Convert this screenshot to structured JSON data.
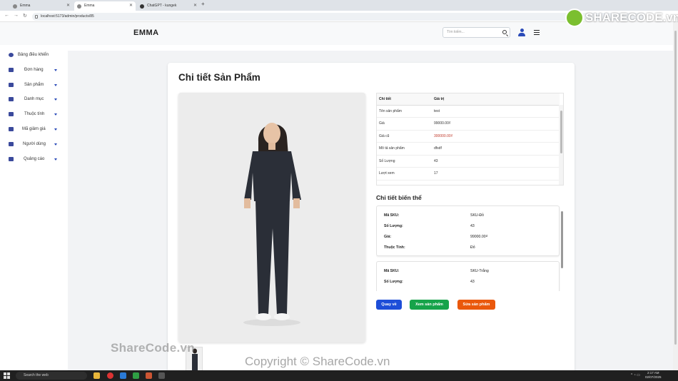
{
  "browser": {
    "tabs": [
      {
        "title": "Emma",
        "active": false
      },
      {
        "title": "Emma",
        "active": true
      },
      {
        "title": "ChatGPT - kungek",
        "active": false
      }
    ],
    "url": "localhost:5173/admin/products/85"
  },
  "header": {
    "brand": "EMMA",
    "search_placeholder": "Tìm kiếm..."
  },
  "sidebar": {
    "items": [
      {
        "label": "Bảng điều khiển",
        "icon": "dashboard-icon",
        "has_caret": false
      },
      {
        "label": "Đơn hàng",
        "icon": "cart-icon",
        "has_caret": true
      },
      {
        "label": "Sản phẩm",
        "icon": "box-icon",
        "has_caret": true
      },
      {
        "label": "Danh mục",
        "icon": "tag-icon",
        "has_caret": true
      },
      {
        "label": "Thuộc tính",
        "icon": "cogs-icon",
        "has_caret": true
      },
      {
        "label": "Mã giảm giá",
        "icon": "ticket-icon",
        "has_caret": true
      },
      {
        "label": "Người dùng",
        "icon": "users-icon",
        "has_caret": true
      },
      {
        "label": "Quảng cáo",
        "icon": "megaphone-icon",
        "has_caret": true
      }
    ]
  },
  "page": {
    "title": "Chi tiết Sản Phẩm",
    "attr_table": {
      "headers": [
        "Chi tiết",
        "Giá trị"
      ],
      "rows": [
        {
          "key": "Tên sản phẩm",
          "value": "test"
        },
        {
          "key": "Giá",
          "value": "99000.00₫"
        },
        {
          "key": "Giá cũ",
          "value": "300000.00₫"
        },
        {
          "key": "Mô tả sản phẩm",
          "value": "dfsdf"
        },
        {
          "key": "Số Lượng",
          "value": "43"
        },
        {
          "key": "Lượt xem",
          "value": "17"
        }
      ]
    },
    "variants_title": "Chi tiết biến thể",
    "variants": [
      {
        "sku_label": "Mã SKU:",
        "sku": "SKU-Đỏ",
        "qty_label": "Số Lượng:",
        "qty": "43",
        "price_label": "Giá:",
        "price": "99000.00₫",
        "attr_label": "Thuộc Tính:",
        "attr": "Đỏ"
      },
      {
        "sku_label": "Mã SKU:",
        "sku": "SKU-Trắng",
        "qty_label": "Số Lượng:",
        "qty": "43"
      }
    ],
    "buttons": {
      "back": "Quay về",
      "view": "Xem sản phẩm",
      "edit": "Sửa sản phẩm"
    }
  },
  "watermarks": {
    "left": "ShareCode.vn",
    "center": "Copyright © ShareCode.vn",
    "logo": "SHARECODE.vn"
  },
  "taskbar": {
    "search": "Search the web",
    "time": "2:17 AM",
    "date": "02/07/2025"
  },
  "colors": {
    "primary": "#1d4ed8",
    "success": "#16a34a",
    "warning": "#ea580c",
    "old_price": "#c0392b"
  }
}
